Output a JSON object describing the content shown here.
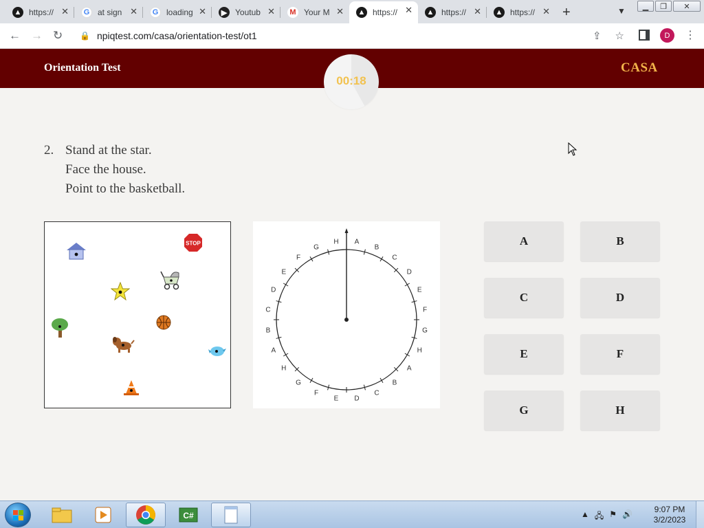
{
  "browser": {
    "tabs": [
      {
        "label": "https://",
        "icon": "vercel-triangle-icon"
      },
      {
        "label": "at sign",
        "icon": "google-icon"
      },
      {
        "label": "loading",
        "icon": "google-icon"
      },
      {
        "label": "Youtub",
        "icon": "youtube-icon"
      },
      {
        "label": "Your M",
        "icon": "gmail-icon"
      },
      {
        "label": "https://",
        "icon": "vercel-triangle-icon",
        "active": true
      },
      {
        "label": "https://",
        "icon": "vercel-triangle-icon"
      },
      {
        "label": "https://",
        "icon": "vercel-triangle-icon"
      }
    ],
    "url": "npiqtest.com/casa/orientation-test/ot1",
    "profile_initial": "D"
  },
  "header": {
    "title": "Orientation Test",
    "brand": "CASA",
    "timer": "00:18"
  },
  "question": {
    "number": "2.",
    "lines": [
      "Stand at the star.",
      "Face the house.",
      "Point to the basketball."
    ]
  },
  "map_items": [
    {
      "name": "house-icon",
      "symbol": "house"
    },
    {
      "name": "stop-sign-icon",
      "symbol": "STOP"
    },
    {
      "name": "stroller-icon",
      "symbol": "stroller"
    },
    {
      "name": "star-icon",
      "symbol": "star"
    },
    {
      "name": "tree-icon",
      "symbol": "tree"
    },
    {
      "name": "basketball-icon",
      "symbol": "basketball"
    },
    {
      "name": "dog-icon",
      "symbol": "dog"
    },
    {
      "name": "bird-icon",
      "symbol": "bird"
    },
    {
      "name": "traffic-cone-icon",
      "symbol": "cone"
    }
  ],
  "dial": {
    "labels": [
      "A",
      "B",
      "C",
      "D",
      "E",
      "F",
      "G",
      "H",
      "A",
      "B",
      "C",
      "D",
      "E",
      "F",
      "G",
      "H",
      "A",
      "B",
      "C",
      "D",
      "E",
      "F",
      "G",
      "H"
    ],
    "pointer": "up"
  },
  "answers": [
    {
      "label": "A"
    },
    {
      "label": "B"
    },
    {
      "label": "C"
    },
    {
      "label": "D"
    },
    {
      "label": "E"
    },
    {
      "label": "F"
    },
    {
      "label": "G"
    },
    {
      "label": "H"
    }
  ],
  "taskbar": {
    "clock_time": "9:07 PM",
    "clock_date": "3/2/2023"
  },
  "colors": {
    "header_bg": "#620000",
    "brand": "#f2b44a",
    "timer_text": "#f2c24f",
    "button_bg": "#e6e5e4"
  }
}
